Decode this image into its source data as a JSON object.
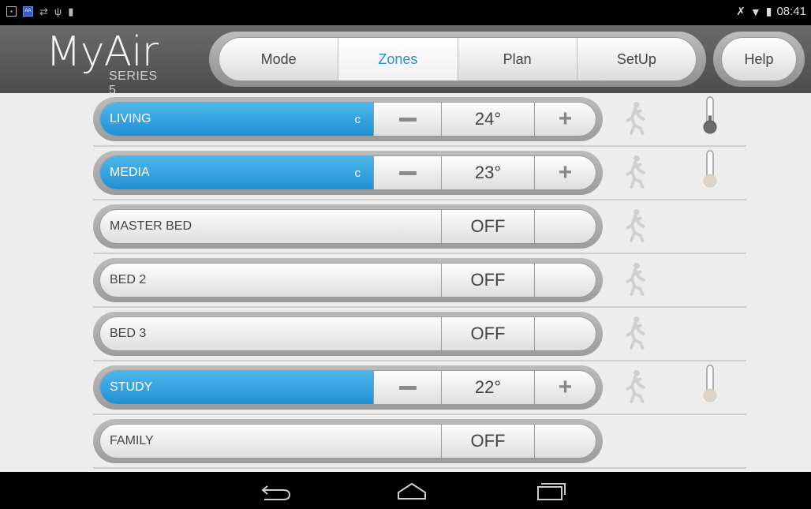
{
  "status": {
    "time": "08:41"
  },
  "header": {
    "logo": {
      "title": "MyAir",
      "subtitle": "SERIES 5"
    },
    "tabs": [
      {
        "label": "Mode",
        "active": false
      },
      {
        "label": "Zones",
        "active": true
      },
      {
        "label": "Plan",
        "active": false
      },
      {
        "label": "SetUp",
        "active": false
      }
    ],
    "help_label": "Help"
  },
  "zones": [
    {
      "name": "LIVING",
      "on": true,
      "flag": "c",
      "temp": "24°",
      "thermo_fill": 0.35
    },
    {
      "name": "MEDIA",
      "on": true,
      "flag": "c",
      "temp": "23°",
      "thermo_fill": 0.15
    },
    {
      "name": "MASTER BED",
      "on": false,
      "temp": "OFF"
    },
    {
      "name": "BED 2",
      "on": false,
      "temp": "OFF"
    },
    {
      "name": "BED 3",
      "on": false,
      "temp": "OFF"
    },
    {
      "name": "STUDY",
      "on": true,
      "flag": "",
      "temp": "22°",
      "thermo_fill": 0.15
    },
    {
      "name": "FAMILY",
      "on": false,
      "temp": "OFF",
      "no_motion": true
    }
  ],
  "colors": {
    "accent": "#2a8fd0",
    "zone_on": "#1f90d4"
  }
}
